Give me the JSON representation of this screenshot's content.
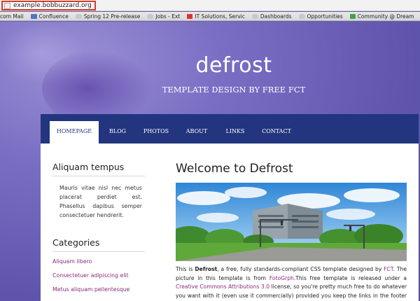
{
  "browser": {
    "url": "example.bobbuzzard.org",
    "bookmarks": [
      {
        "label": "com Mail",
        "icon": "none"
      },
      {
        "label": "Confluence",
        "icon": "x"
      },
      {
        "label": "Spring 12 Pre-release",
        "icon": "cloud"
      },
      {
        "label": "Jobs - Ext",
        "icon": "cloud"
      },
      {
        "label": "IT Solutions, Servic",
        "icon": "red"
      },
      {
        "label": "Dashboards",
        "icon": "cloud"
      },
      {
        "label": "Opportunities",
        "icon": "cloud"
      },
      {
        "label": "Community @ Dream",
        "icon": "grid"
      }
    ]
  },
  "site": {
    "title": "defrost",
    "tagline": "TEMPLATE DESIGN BY FREE FCT"
  },
  "nav": [
    {
      "label": "HOMEPAGE",
      "active": true
    },
    {
      "label": "BLOG",
      "active": false
    },
    {
      "label": "PHOTOS",
      "active": false
    },
    {
      "label": "ABOUT",
      "active": false
    },
    {
      "label": "LINKS",
      "active": false
    },
    {
      "label": "CONTACT",
      "active": false
    }
  ],
  "sidebar": {
    "heading1": "Aliquam tempus",
    "text": "Mauris vitae nisl nec metus placerat perdiet est. Phasellus dapibus semper consectetuer hendrerit.",
    "heading2": "Categories",
    "categories": [
      "Aliquam libero",
      "Consectetuer adipiscing elit",
      "Metus aliquam pellentesque"
    ]
  },
  "main": {
    "heading": "Welcome to Defrost",
    "p_1": "This is ",
    "p_bold": "Defrost",
    "p_2": ", a free, fully standards-compliant CSS template designed by ",
    "p_link_fct": "FCT",
    "p_3": ". The picture in this template is from ",
    "p_link_foto": "FotoGrph",
    "p_4": ".This free template is released under a ",
    "p_link_cc": "Creative Commons Attributions 3.0",
    "p_5": " license, so you're pretty much free to do whatever you want with it (even use it commercially) provided you keep the links in the footer intact. Aside from that, have fun with it :)"
  },
  "colors": {
    "nav_bg": "#23357e",
    "link": "#8a2a7a",
    "page_bg": "#6a5fb0",
    "url_highlight": "#d9382a"
  }
}
